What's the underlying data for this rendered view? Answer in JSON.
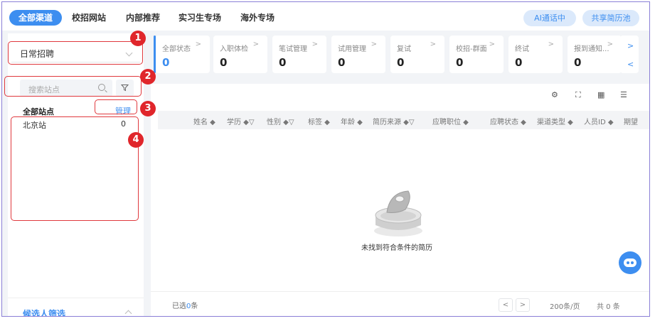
{
  "nav": {
    "tabs": [
      "全部渠道",
      "校招网站",
      "内部推荐",
      "实习生专场",
      "海外专场"
    ],
    "ai_button": "AI通话中",
    "share_button": "共享简历池"
  },
  "sidebar": {
    "select_value": "日常招聘",
    "search_placeholder": "搜索站点",
    "all_sites_label": "全部站点",
    "manage_label": "管理",
    "sites": [
      {
        "name": "北京站",
        "count": "0"
      }
    ],
    "candidate_filter": "候选人筛选"
  },
  "badges": [
    "1",
    "2",
    "3",
    "4"
  ],
  "stage_cards": [
    {
      "label": "全部状态",
      "value": "0"
    },
    {
      "label": "入职体检",
      "value": "0"
    },
    {
      "label": "笔试管理",
      "value": "0"
    },
    {
      "label": "试用管理",
      "value": "0"
    },
    {
      "label": "复试",
      "value": "0"
    },
    {
      "label": "校招-群面",
      "value": "0"
    },
    {
      "label": "终试",
      "value": "0"
    },
    {
      "label": "报到通知...",
      "value": "0"
    }
  ],
  "table": {
    "columns": [
      "姓名",
      "学历",
      "性别",
      "标签",
      "年龄",
      "简历来源",
      "应聘职位",
      "应聘状态",
      "渠道类型",
      "人员ID",
      "期望"
    ],
    "empty_text": "未找到符合条件的简历"
  },
  "footer": {
    "selected_prefix": "已选",
    "selected_count": "0",
    "selected_suffix": "条",
    "page_size": "200条/页",
    "total": "共 0 条"
  },
  "colors": {
    "accent": "#3d8ef0",
    "annotation": "#e0262b",
    "border": "#8a7fd6"
  }
}
